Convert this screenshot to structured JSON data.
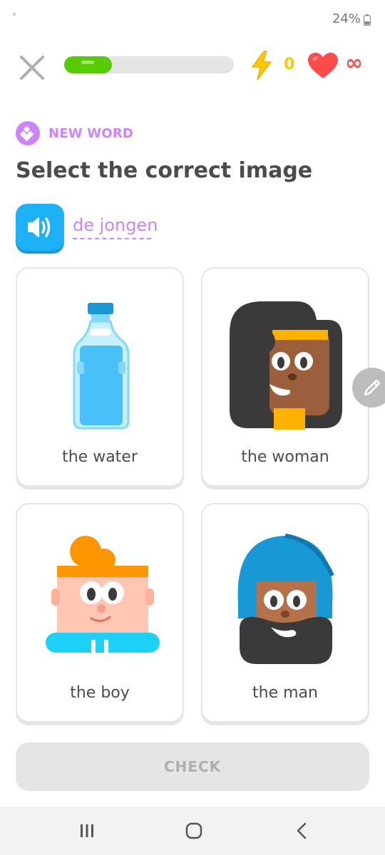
{
  "status_bar": {
    "battery": "24%"
  },
  "lesson": {
    "progress_fraction": 0.28,
    "energy_count": "0",
    "hearts_count": "∞"
  },
  "badge": {
    "label": "NEW WORD"
  },
  "prompt": "Select the correct image",
  "target_word": "de jongen",
  "choices": [
    {
      "label": "the water",
      "icon": "water-bottle"
    },
    {
      "label": "the woman",
      "icon": "woman-character"
    },
    {
      "label": "the boy",
      "icon": "boy-character"
    },
    {
      "label": "the man",
      "icon": "man-character"
    }
  ],
  "check_button": "CHECK",
  "colors": {
    "progress_green": "#58cc02",
    "badge_purple": "#ce82ff",
    "speaker_blue": "#1cb0f6",
    "heart_red": "#ff4b4b",
    "bolt_yellow": "#ffc800"
  }
}
